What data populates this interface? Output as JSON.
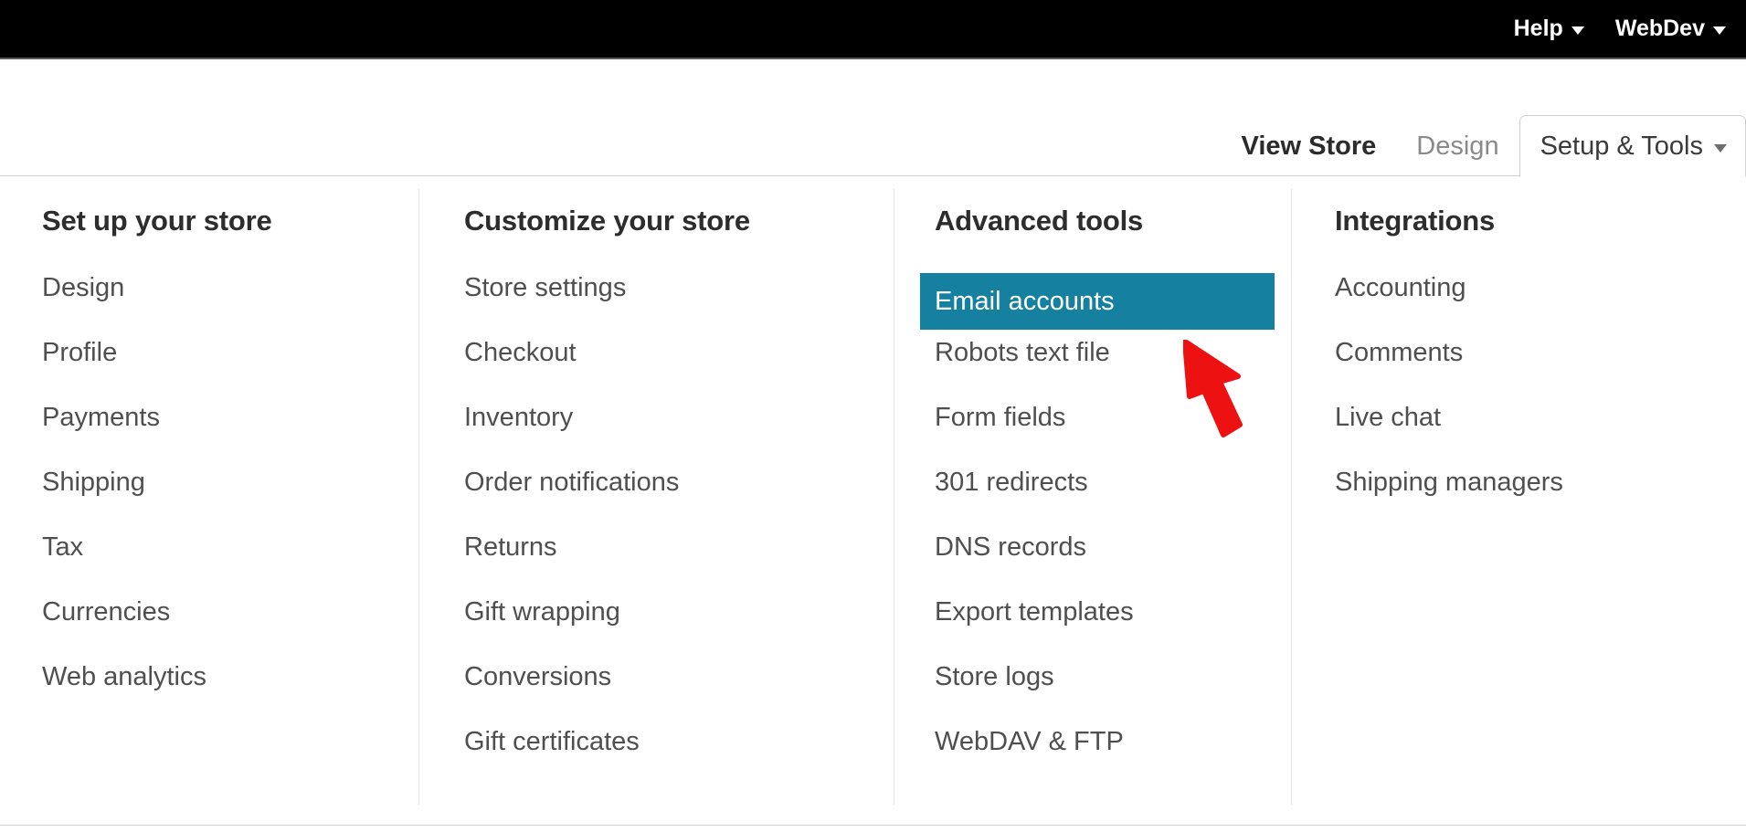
{
  "topbar": {
    "menus": [
      {
        "label": "Help",
        "icon": "chevron-down-icon"
      },
      {
        "label": "WebDev",
        "icon": "chevron-down-icon"
      }
    ]
  },
  "tabs": [
    {
      "label": "View Store",
      "state": "link"
    },
    {
      "label": "Design",
      "state": "muted"
    },
    {
      "label": "Setup & Tools",
      "state": "active",
      "icon": "chevron-down-icon"
    }
  ],
  "menu_panel": {
    "columns": [
      {
        "title": "Set up your store",
        "items": [
          {
            "label": "Design"
          },
          {
            "label": "Profile"
          },
          {
            "label": "Payments"
          },
          {
            "label": "Shipping"
          },
          {
            "label": "Tax"
          },
          {
            "label": "Currencies"
          },
          {
            "label": "Web analytics"
          }
        ]
      },
      {
        "title": "Customize your store",
        "items": [
          {
            "label": "Store settings"
          },
          {
            "label": "Checkout"
          },
          {
            "label": "Inventory"
          },
          {
            "label": "Order notifications"
          },
          {
            "label": "Returns"
          },
          {
            "label": "Gift wrapping"
          },
          {
            "label": "Conversions"
          },
          {
            "label": "Gift certificates"
          }
        ]
      },
      {
        "title": "Advanced tools",
        "items": [
          {
            "label": "Email accounts",
            "highlighted": true
          },
          {
            "label": "Robots text file"
          },
          {
            "label": "Form fields"
          },
          {
            "label": "301 redirects"
          },
          {
            "label": "DNS records"
          },
          {
            "label": "Export templates"
          },
          {
            "label": "Store logs"
          },
          {
            "label": "WebDAV & FTP"
          }
        ]
      },
      {
        "title": "Integrations",
        "items": [
          {
            "label": "Accounting"
          },
          {
            "label": "Comments"
          },
          {
            "label": "Live chat"
          },
          {
            "label": "Shipping managers"
          }
        ]
      }
    ]
  },
  "annotation": {
    "type": "arrow",
    "color": "#ee1111",
    "points_to": "Email accounts"
  },
  "colors": {
    "highlight": "#15809f",
    "topbar_bg": "#000000",
    "link": "#4f4f4f",
    "title": "#2d2d2d",
    "border": "#cfcfcf"
  }
}
